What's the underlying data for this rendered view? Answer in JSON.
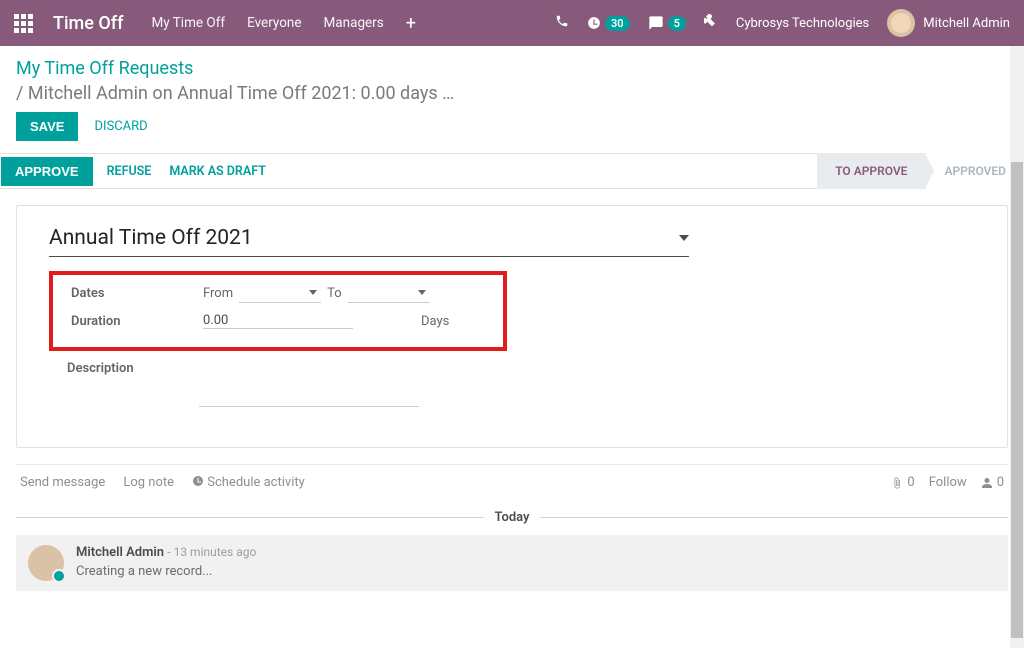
{
  "topbar": {
    "brand": "Time Off",
    "nav": [
      "My Time Off",
      "Everyone",
      "Managers"
    ],
    "badge_clock": "30",
    "badge_chat": "5",
    "company": "Cybrosys Technologies",
    "user": "Mitchell Admin"
  },
  "breadcrumb": {
    "parent": "My Time Off Requests",
    "current": "/  Mitchell Admin on Annual Time Off 2021: 0.00 days …"
  },
  "buttons": {
    "save": "SAVE",
    "discard": "DISCARD",
    "approve": "APPROVE",
    "refuse": "REFUSE",
    "mark_draft": "MARK AS DRAFT"
  },
  "stages": {
    "to_approve": "TO APPROVE",
    "approved": "APPROVED"
  },
  "form": {
    "type_value": "Annual Time Off 2021",
    "dates_label": "Dates",
    "from_label": "From",
    "to_label": "To",
    "duration_label": "Duration",
    "duration_value": "0.00",
    "duration_unit": "Days",
    "description_label": "Description"
  },
  "chatter": {
    "send_message": "Send message",
    "log_note": "Log note",
    "schedule_activity": "Schedule activity",
    "attach_count": "0",
    "follow": "Follow",
    "followers_count": "0",
    "separator": "Today",
    "msg_author": "Mitchell Admin",
    "msg_time": "- 13 minutes ago",
    "msg_text": "Creating a new record..."
  }
}
